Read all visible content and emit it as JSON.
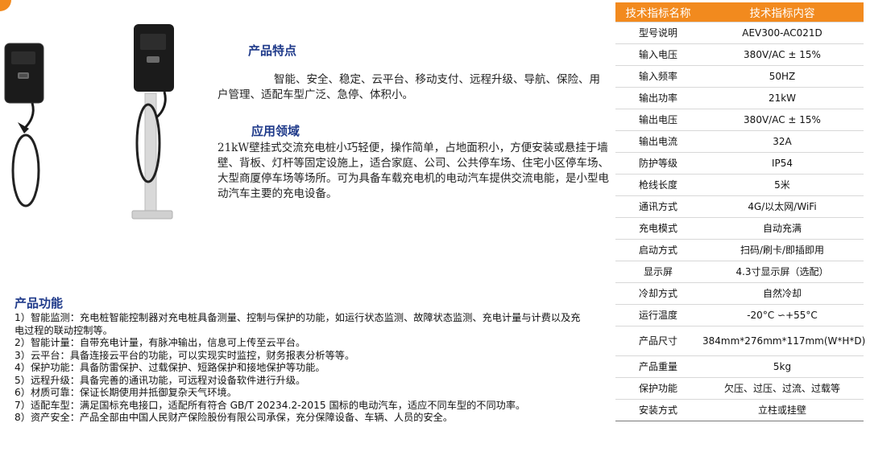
{
  "features": {
    "title": "产品特点",
    "text": "智能、安全、稳定、云平台、移动支付、远程升级、导航、保险、用户管理、适配车型广泛、急停、体积小。"
  },
  "applications": {
    "title": "应用领域",
    "text": "21kW壁挂式交流充电桩小巧轻便，操作简单，占地面积小，方便安装或悬挂于墙壁、背板、灯杆等固定设施上，适合家庭、公司、公共停车场、住宅小区停车场、大型商厦停车场等场所。可为具备车载充电机的电动汽车提供交流电能，是小型电动汽车主要的充电设备。"
  },
  "functions": {
    "title": "产品功能",
    "items": [
      "1）智能监测：充电桩智能控制器对充电桩具备测量、控制与保护的功能，如运行状态监测、故障状态监测、充电计量与计费以及充电过程的联动控制等。",
      "2）智能计量：自带充电计量，有脉冲输出，信息可上传至云平台。",
      "3）云平台：具备连接云平台的功能，可以实现实时监控，财务报表分析等等。",
      "4）保护功能：具备防雷保护、过载保护、短路保护和接地保护等功能。",
      "5）远程升级：具备完善的通讯功能，可远程对设备软件进行升级。",
      "6）材质可靠：保证长期使用并抵御复杂天气环境。",
      "7）适配车型：满足国标充电接口，适配所有符合 GB/T 20234.2-2015 国标的电动汽车，适应不同车型的不同功率。",
      "8）资产安全：产品全部由中国人民财产保险股份有限公司承保，充分保障设备、车辆、人员的安全。"
    ]
  },
  "specs": {
    "header": [
      "技术指标名称",
      "技术指标内容"
    ],
    "rows": [
      [
        "型号说明",
        "AEV300-AC021D"
      ],
      [
        "输入电压",
        "380V/AC ± 15%"
      ],
      [
        "输入频率",
        "50HZ"
      ],
      [
        "输出功率",
        "21kW"
      ],
      [
        "输出电压",
        "380V/AC ± 15%"
      ],
      [
        "输出电流",
        "32A"
      ],
      [
        "防护等级",
        "IP54"
      ],
      [
        "枪线长度",
        "5米"
      ],
      [
        "通讯方式",
        "4G/以太网/WiFi"
      ],
      [
        "充电模式",
        "自动充满"
      ],
      [
        "启动方式",
        "扫码/刷卡/即插即用"
      ],
      [
        "显示屏",
        "4.3寸显示屏（选配）"
      ],
      [
        "冷却方式",
        "自然冷却"
      ],
      [
        "运行温度",
        "-20°C ∽+55°C"
      ],
      [
        "产品尺寸",
        "384mm*276mm*117mm(W*H*D)"
      ],
      [
        "产品重量",
        "5kg"
      ],
      [
        "保护功能",
        "欠压、过压、过流、过载等"
      ],
      [
        "安装方式",
        "立柱或挂壁"
      ]
    ]
  },
  "colors": {
    "accent": "#f28a1e",
    "heading": "#1f3a8a",
    "charger_body": "#1b1b1b",
    "charger_base": "#d9d9d9"
  }
}
